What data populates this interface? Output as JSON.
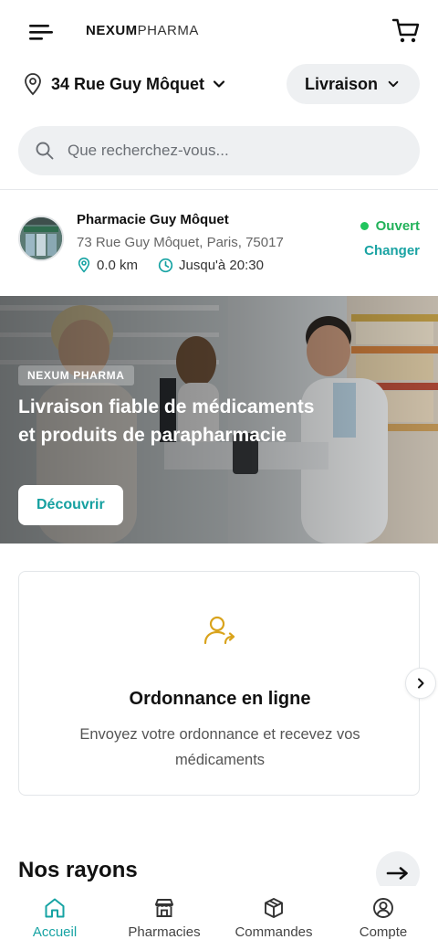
{
  "header": {
    "logo_bold": "NEXUM",
    "logo_light": "PHARMA",
    "menu_icon": "hamburger-menu-icon",
    "cart_icon": "shopping-cart-icon"
  },
  "location": {
    "address": "34 Rue Guy Môquet",
    "delivery_mode": "Livraison"
  },
  "search": {
    "placeholder": "Que recherchez-vous..."
  },
  "pharmacy": {
    "name": "Pharmacie Guy Môquet",
    "address": "73 Rue Guy Môquet, Paris, 75017",
    "distance": "0.0 km",
    "hours": "Jusqu'à 20:30",
    "status": "Ouvert",
    "change_label": "Changer"
  },
  "banner": {
    "badge": "NEXUM PHARMA",
    "title": "Livraison fiable de médicaments et produits de parapharmacie",
    "cta": "Découvrir"
  },
  "feature_card": {
    "icon": "user-share-icon",
    "title": "Ordonnance en ligne",
    "description": "Envoyez votre ordonnance et recevez vos médicaments"
  },
  "sections": {
    "rayons_title": "Nos rayons"
  },
  "bottom_nav": {
    "items": [
      {
        "label": "Accueil",
        "icon": "home-icon",
        "active": true
      },
      {
        "label": "Pharmacies",
        "icon": "store-icon",
        "active": false
      },
      {
        "label": "Commandes",
        "icon": "package-icon",
        "active": false
      },
      {
        "label": "Compte",
        "icon": "user-circle-icon",
        "active": false
      }
    ]
  },
  "colors": {
    "accent": "#16a3a3",
    "open_green": "#22c55e",
    "icon_gold": "#d9a31c"
  }
}
